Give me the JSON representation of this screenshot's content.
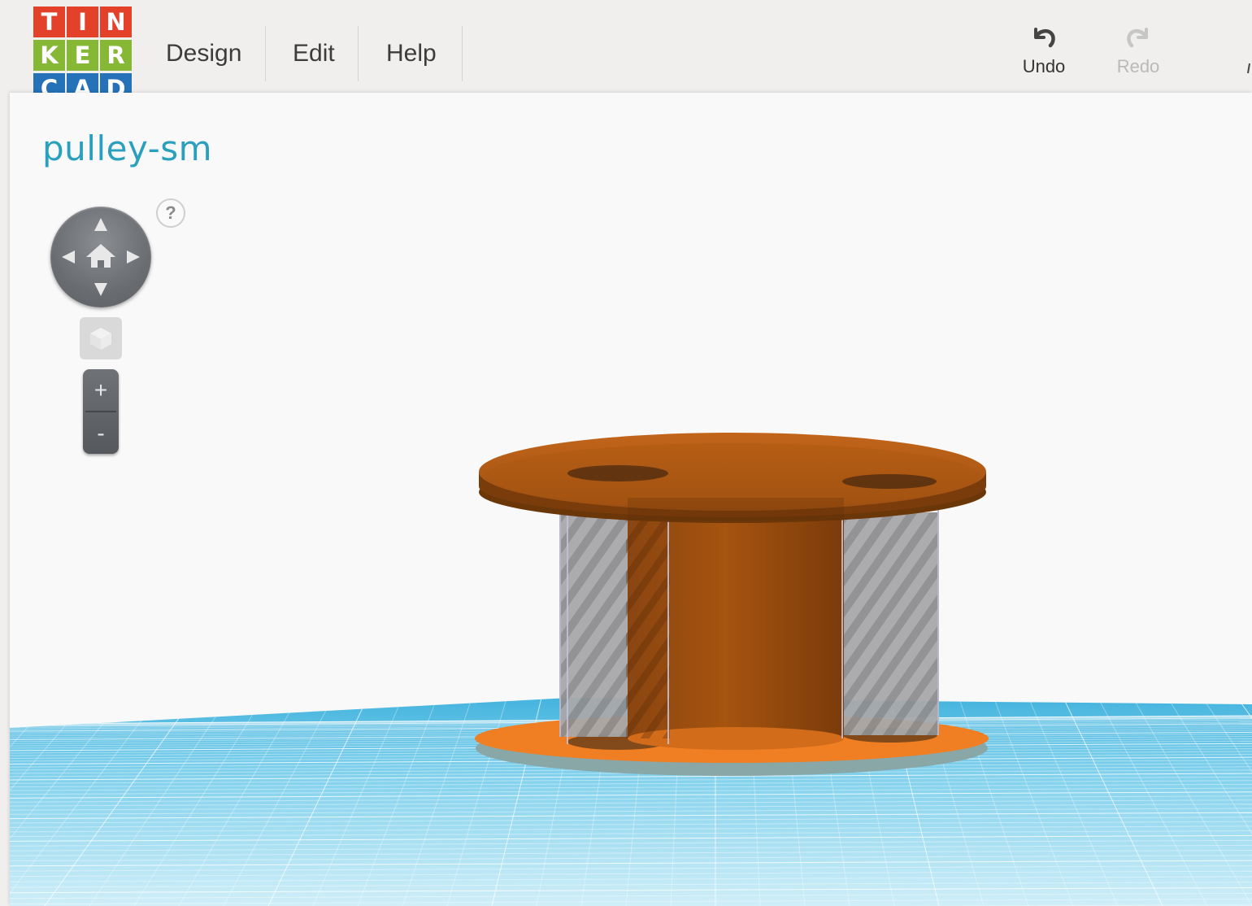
{
  "logo": {
    "letters": [
      "T",
      "I",
      "N",
      "K",
      "E",
      "R",
      "C",
      "A",
      "D"
    ],
    "colors": [
      "#e8482f",
      "#e8482f",
      "#e8482f",
      "#6fb33f",
      "#6fb33f",
      "#6fb33f",
      "#2a6fb7",
      "#2a6fb7",
      "#2a6fb7"
    ],
    "tile_colors": [
      "#e4412a",
      "#e4412a",
      "#e4412a",
      "#86b835",
      "#86b835",
      "#86b835",
      "#2572b8",
      "#2572b8",
      "#2572b8"
    ]
  },
  "menu": {
    "items": [
      "Design",
      "Edit",
      "Help"
    ]
  },
  "actions": {
    "undo_label": "Undo",
    "redo_label": "Redo",
    "undo_icon": "undo-arrow-icon",
    "redo_icon": "redo-arrow-icon"
  },
  "design": {
    "title": "pulley-sm"
  },
  "controls": {
    "help_label": "?",
    "zoom_in_label": "+",
    "zoom_out_label": "-",
    "home_icon": "home-icon",
    "viewcube_icon": "cube-icon"
  },
  "colors": {
    "accent": "#2a9fbe",
    "workplane": "#5ec4e6",
    "shape_orange": "#c05f10",
    "hole_grey": "#9a9a9a"
  }
}
